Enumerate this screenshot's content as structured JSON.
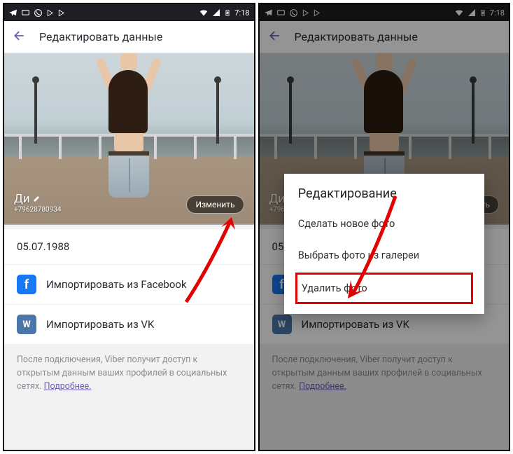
{
  "statusbar": {
    "time": "7:18"
  },
  "header": {
    "title": "Редактировать данные"
  },
  "profile": {
    "name": "Ди",
    "phone": "+79628780934",
    "change_btn": "Изменить"
  },
  "dob": "05.07.1988",
  "imports": {
    "fb": "Импортировать из Facebook",
    "vk": "Импортировать из VK"
  },
  "note": {
    "text": "После подключения, Viber получит доступ к открытым данным ваших профилей в социальных сетях.",
    "link": "Подробнее."
  },
  "dialog": {
    "title": "Редактирование",
    "opt_new": "Сделать новое фото",
    "opt_gallery": "Выбрать фото из галереи",
    "opt_delete": "Удалить фото"
  }
}
